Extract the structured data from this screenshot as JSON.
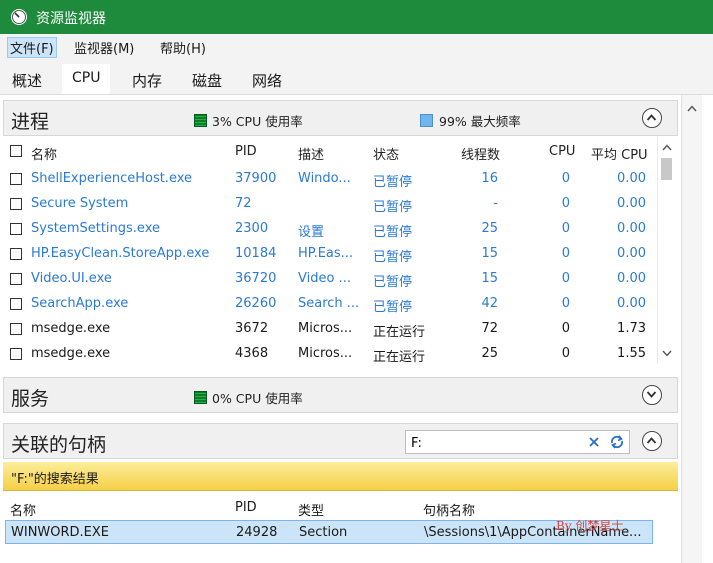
{
  "window": {
    "title": "资源监视器",
    "titlebar_color": "#1e8a3c"
  },
  "menu": [
    "文件(F)",
    "监视器(M)",
    "帮助(H)"
  ],
  "tabs": [
    "概述",
    "CPU",
    "内存",
    "磁盘",
    "网络"
  ],
  "processes": {
    "title": "进程",
    "cpu_usage": "3% CPU 使用率",
    "max_freq": "99% 最大频率",
    "columns": [
      "名称",
      "PID",
      "描述",
      "状态",
      "线程数",
      "CPU",
      "平均 CPU"
    ],
    "rows": [
      {
        "name": "ShellExperienceHost.exe",
        "pid": "37900",
        "desc": "Windo...",
        "status": "已暂停",
        "threads": "16",
        "cpu": "0",
        "avg": "0.00",
        "suspended": true
      },
      {
        "name": "Secure System",
        "pid": "72",
        "desc": "",
        "status": "已暂停",
        "threads": "-",
        "cpu": "0",
        "avg": "0.00",
        "suspended": true
      },
      {
        "name": "SystemSettings.exe",
        "pid": "2300",
        "desc": "设置",
        "status": "已暂停",
        "threads": "25",
        "cpu": "0",
        "avg": "0.00",
        "suspended": true
      },
      {
        "name": "HP.EasyClean.StoreApp.exe",
        "pid": "10184",
        "desc": "HP.Eas...",
        "status": "已暂停",
        "threads": "15",
        "cpu": "0",
        "avg": "0.00",
        "suspended": true
      },
      {
        "name": "Video.UI.exe",
        "pid": "36720",
        "desc": "Video ...",
        "status": "已暂停",
        "threads": "15",
        "cpu": "0",
        "avg": "0.00",
        "suspended": true
      },
      {
        "name": "SearchApp.exe",
        "pid": "26260",
        "desc": "Search ...",
        "status": "已暂停",
        "threads": "42",
        "cpu": "0",
        "avg": "0.00",
        "suspended": true
      },
      {
        "name": "msedge.exe",
        "pid": "3672",
        "desc": "Micros...",
        "status": "正在运行",
        "threads": "72",
        "cpu": "0",
        "avg": "1.73",
        "suspended": false
      },
      {
        "name": "msedge.exe",
        "pid": "4368",
        "desc": "Micros...",
        "status": "正在运行",
        "threads": "25",
        "cpu": "0",
        "avg": "1.55",
        "suspended": false
      }
    ]
  },
  "services": {
    "title": "服务",
    "cpu_usage": "0% CPU 使用率"
  },
  "handles": {
    "title": "关联的句柄",
    "search_value": "F:",
    "result_text": "\"F:\"的搜索结果",
    "columns": [
      "名称",
      "PID",
      "类型",
      "句柄名称"
    ],
    "rows": [
      {
        "name": "WINWORD.EXE",
        "pid": "24928",
        "type": "Section",
        "handle": "\\Sessions\\1\\AppContainerName..."
      }
    ]
  },
  "watermark": "By 创梦星士"
}
